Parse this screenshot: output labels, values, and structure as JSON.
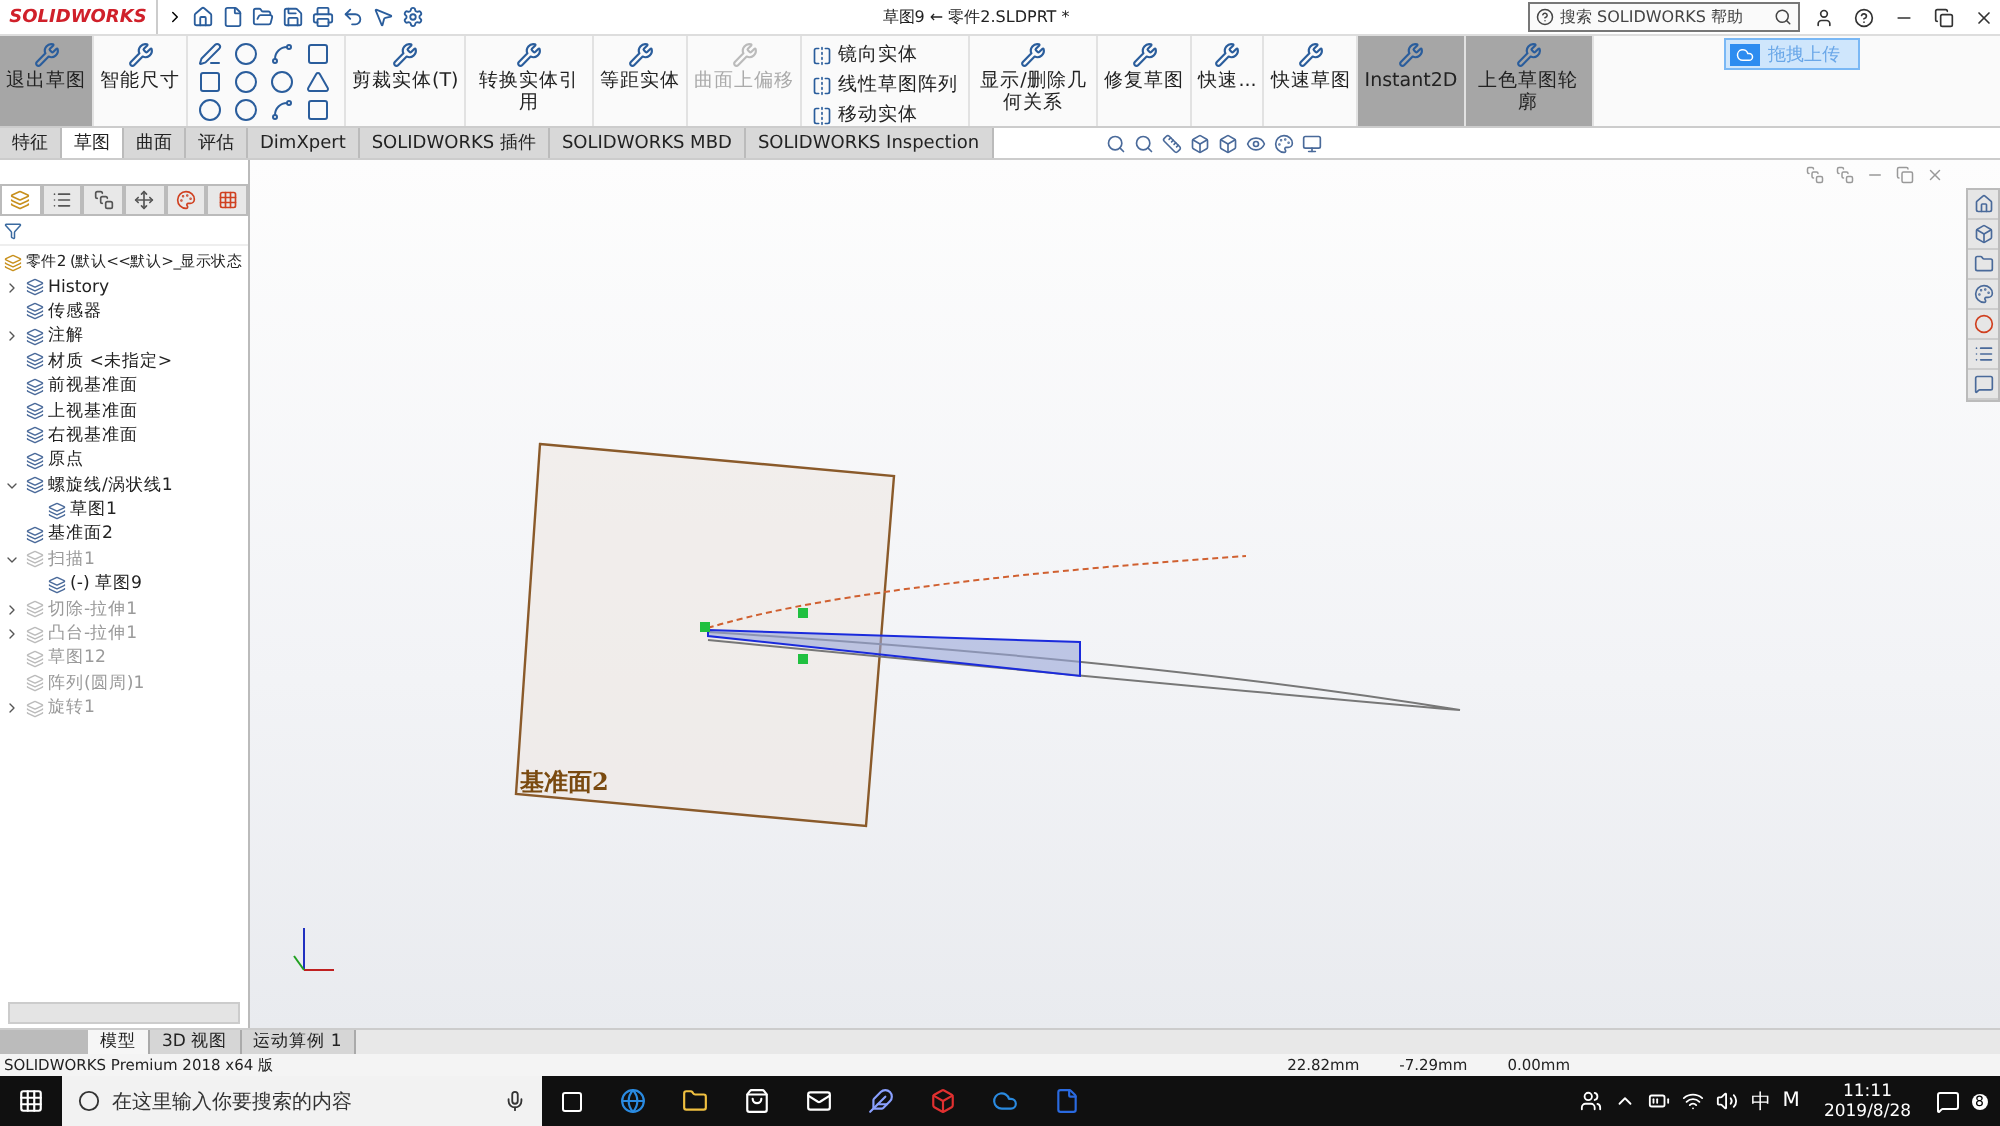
{
  "app": {
    "logo": "SOLIDWORKS",
    "title": "草图9 ← 零件2.SLDPRT *",
    "search_placeholder": "搜索 SOLIDWORKS 帮助"
  },
  "upload_button": "拖拽上传",
  "ribbon": [
    {
      "kind": "button",
      "label": "退出草图",
      "selected": true,
      "disabled": false
    },
    {
      "kind": "button",
      "label": "智能尺寸",
      "selected": false,
      "disabled": false
    },
    {
      "kind": "tools"
    },
    {
      "kind": "button",
      "label": "剪裁实体(T)",
      "selected": false,
      "disabled": false
    },
    {
      "kind": "button",
      "label": "转换实体引用",
      "selected": false,
      "disabled": false
    },
    {
      "kind": "button",
      "label": "等距实体",
      "selected": false,
      "disabled": false
    },
    {
      "kind": "button",
      "label": "曲面上偏移",
      "selected": false,
      "disabled": true
    },
    {
      "kind": "stack",
      "items": [
        "镜向实体",
        "线性草图阵列",
        "移动实体"
      ]
    },
    {
      "kind": "button",
      "label": "显示/删除几何关系",
      "selected": false,
      "disabled": false
    },
    {
      "kind": "button",
      "label": "修复草图",
      "selected": false,
      "disabled": false
    },
    {
      "kind": "button",
      "label": "快速...",
      "selected": false,
      "disabled": false
    },
    {
      "kind": "button",
      "label": "快速草图",
      "selected": false,
      "disabled": false
    },
    {
      "kind": "button",
      "label": "Instant2D",
      "selected": true,
      "disabled": false
    },
    {
      "kind": "button",
      "label": "上色草图轮廓",
      "selected": true,
      "disabled": false
    }
  ],
  "tabs": [
    {
      "label": "特征",
      "selected": false
    },
    {
      "label": "草图",
      "selected": true
    },
    {
      "label": "曲面",
      "selected": false
    },
    {
      "label": "评估",
      "selected": false
    },
    {
      "label": "DimXpert",
      "selected": false
    },
    {
      "label": "SOLIDWORKS 插件",
      "selected": false
    },
    {
      "label": "SOLIDWORKS MBD",
      "selected": false
    },
    {
      "label": "SOLIDWORKS Inspection",
      "selected": false
    }
  ],
  "panel_tabs": [
    {
      "selected": true
    },
    {
      "selected": false
    },
    {
      "selected": false
    },
    {
      "selected": false
    },
    {
      "selected": false
    },
    {
      "selected": false
    }
  ],
  "tree": {
    "root": "零件2  (默认<<默认>_显示状态",
    "items": [
      {
        "label": "History",
        "expanded": false,
        "dimmed": false
      },
      {
        "label": "传感器",
        "dimmed": false
      },
      {
        "label": "注解",
        "expanded": false,
        "dimmed": false
      },
      {
        "label": "材质 <未指定>",
        "dimmed": false
      },
      {
        "label": "前视基准面",
        "dimmed": false
      },
      {
        "label": "上视基准面",
        "dimmed": false
      },
      {
        "label": "右视基准面",
        "dimmed": false
      },
      {
        "label": "原点",
        "dimmed": false
      },
      {
        "label": "螺旋线/涡状线1",
        "expanded": true,
        "dimmed": false,
        "children": [
          {
            "label": "草图1",
            "dimmed": false
          }
        ]
      },
      {
        "label": "基准面2",
        "dimmed": false
      },
      {
        "label": "扫描1",
        "expanded": true,
        "dimmed": true,
        "children": [
          {
            "label": "(-) 草图9",
            "dimmed": false
          }
        ]
      },
      {
        "label": "切除-拉伸1",
        "expanded": false,
        "dimmed": true
      },
      {
        "label": "凸台-拉伸1",
        "expanded": false,
        "dimmed": true
      },
      {
        "label": "草图12",
        "dimmed": true
      },
      {
        "label": "阵列(圆周)1",
        "dimmed": true
      },
      {
        "label": "旋转1",
        "expanded": false,
        "dimmed": true
      }
    ]
  },
  "viewport": {
    "plane_label": "基准面2"
  },
  "bottom_tabs": [
    {
      "label": "模型",
      "selected": true
    },
    {
      "label": "3D 视图",
      "selected": false
    },
    {
      "label": "运动算例 1",
      "selected": false
    }
  ],
  "status": {
    "product": "SOLIDWORKS Premium 2018 x64 版",
    "readings": [
      "22.82mm",
      "-7.29mm",
      "0.00mm"
    ]
  },
  "taskbar": {
    "search_placeholder": "在这里输入你要搜索的内容",
    "ime": "中",
    "ime_mode": "M",
    "time": "11:11",
    "date": "2019/8/28",
    "notifications": "8"
  }
}
